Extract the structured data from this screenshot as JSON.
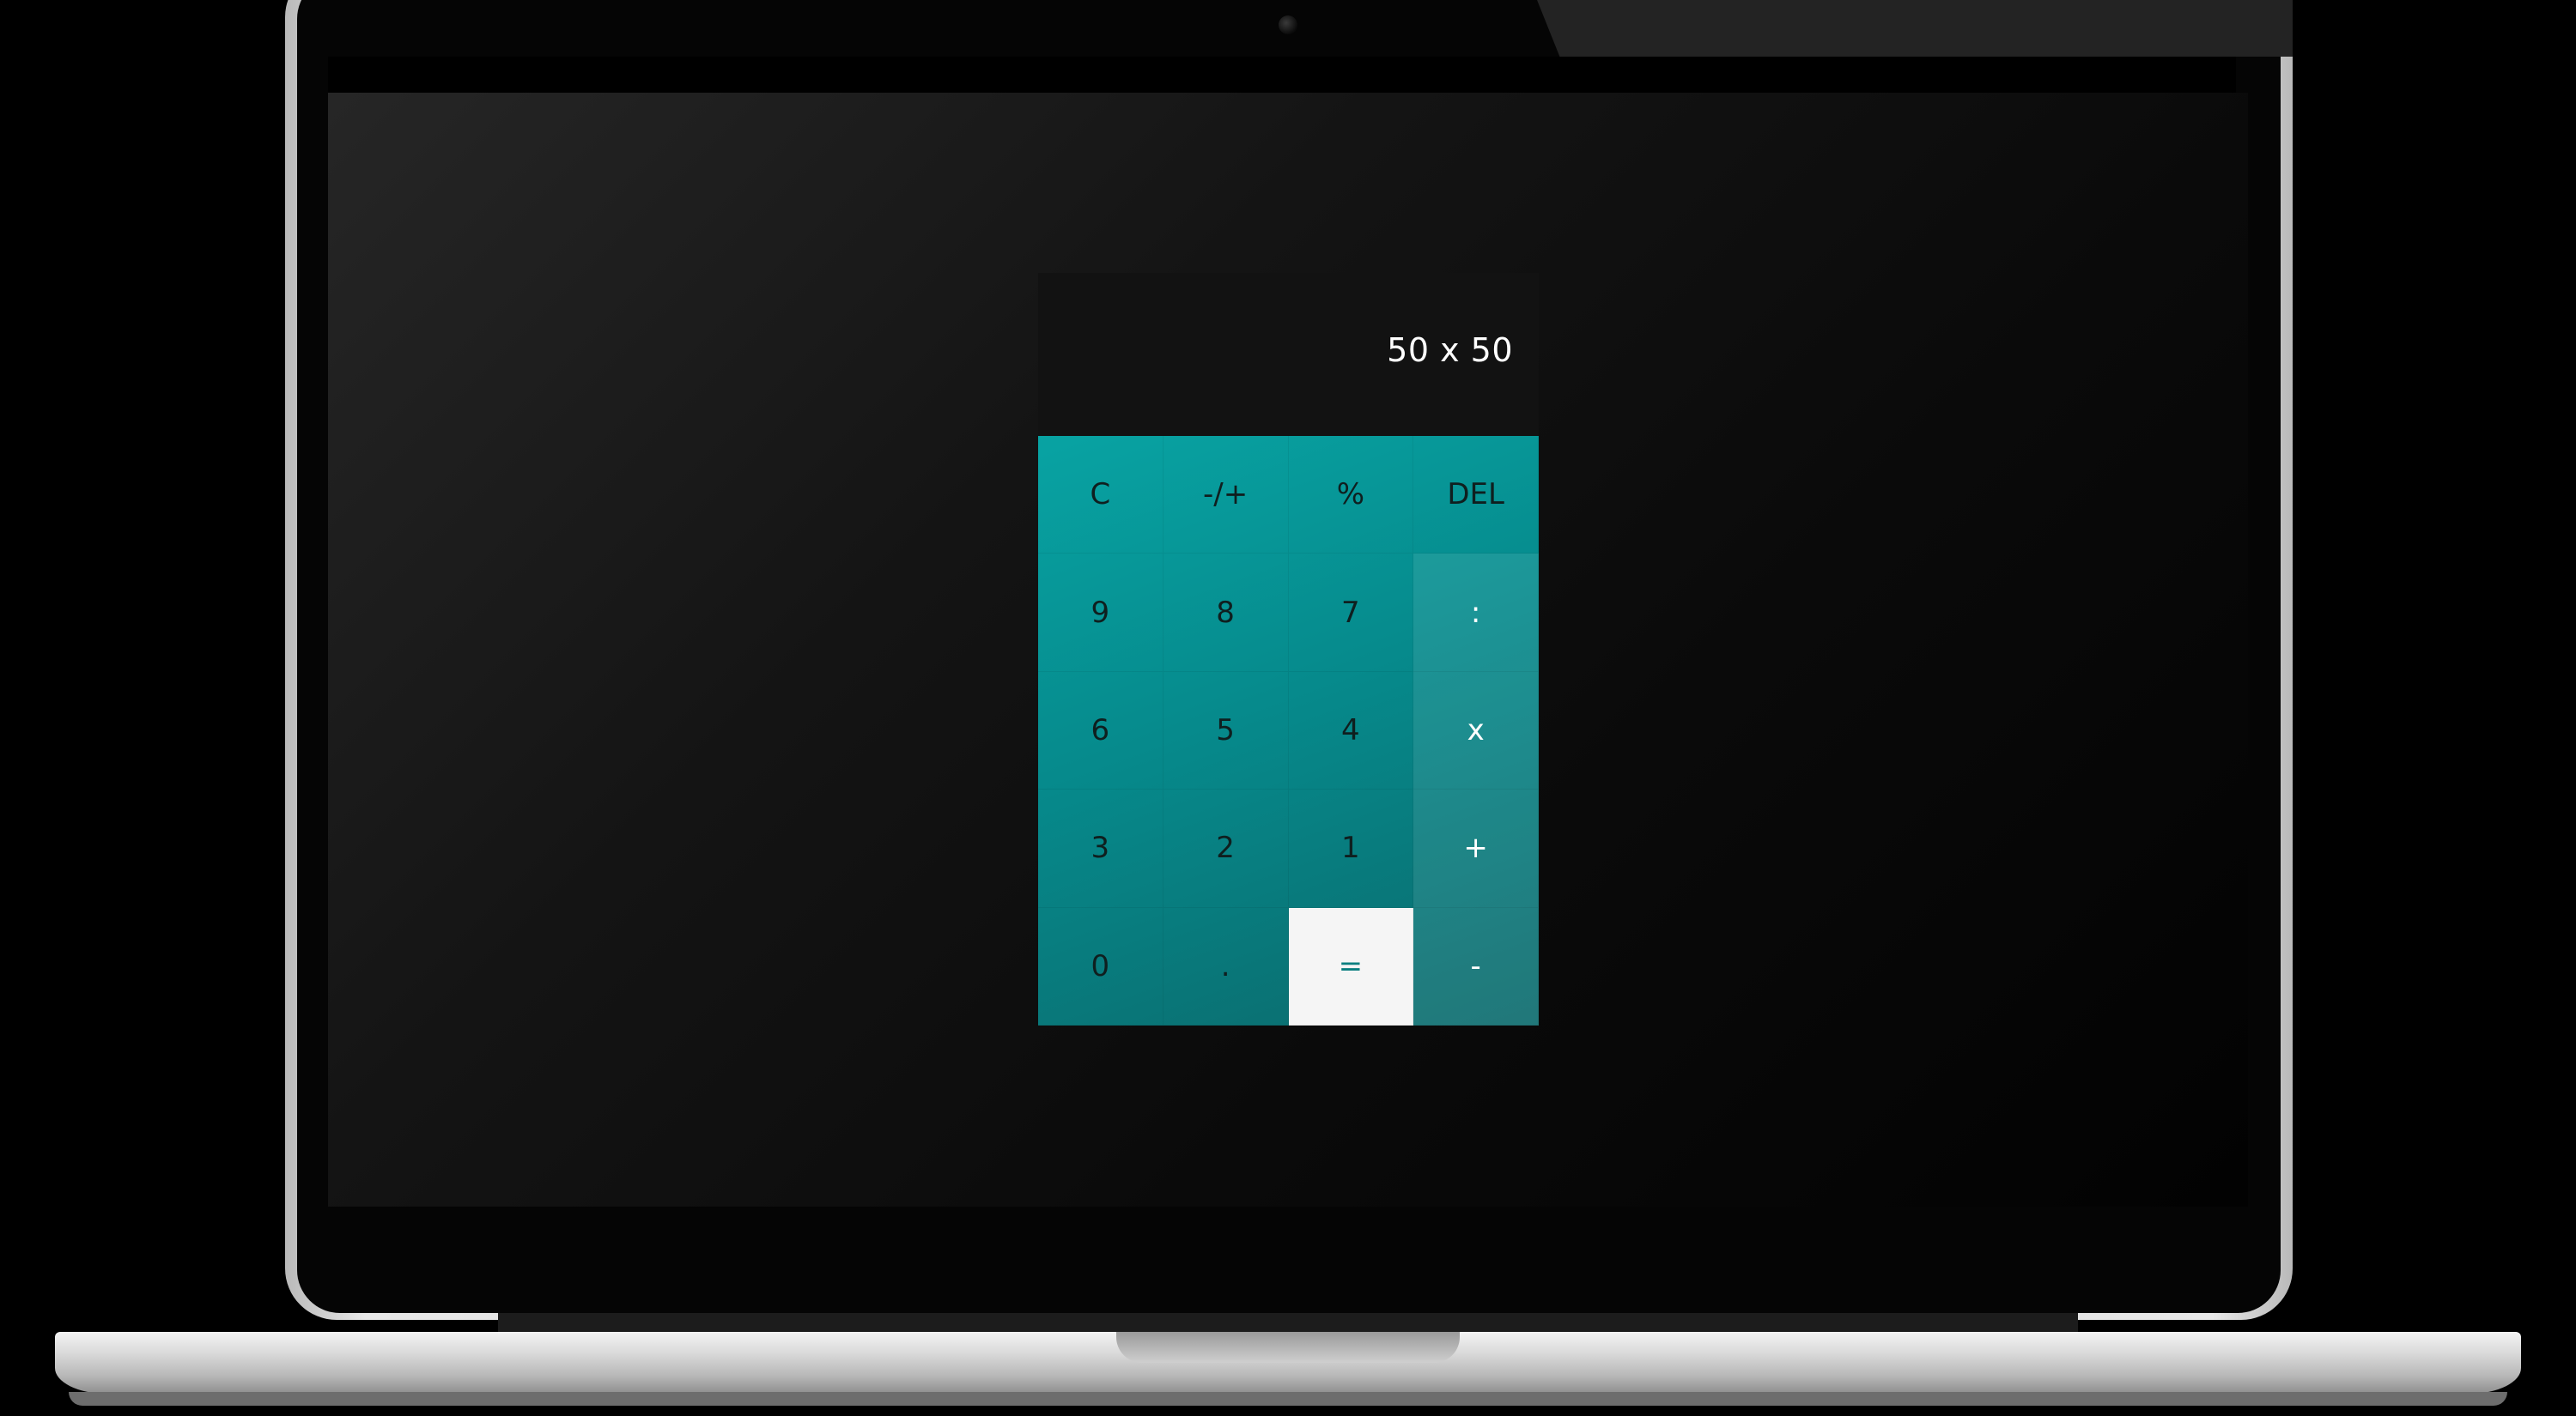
{
  "calculator": {
    "display": "50 x 50",
    "rows": [
      [
        "C",
        "-/+",
        "%",
        "DEL"
      ],
      [
        "9",
        "8",
        "7",
        ":"
      ],
      [
        "6",
        "5",
        "4",
        "x"
      ],
      [
        "3",
        "2",
        "1",
        "+"
      ],
      [
        "0",
        ".",
        "=",
        "-"
      ]
    ]
  },
  "colors": {
    "accent": "#068a8c",
    "display_bg": "#121212",
    "equals_bg": "#f5f5f5"
  }
}
